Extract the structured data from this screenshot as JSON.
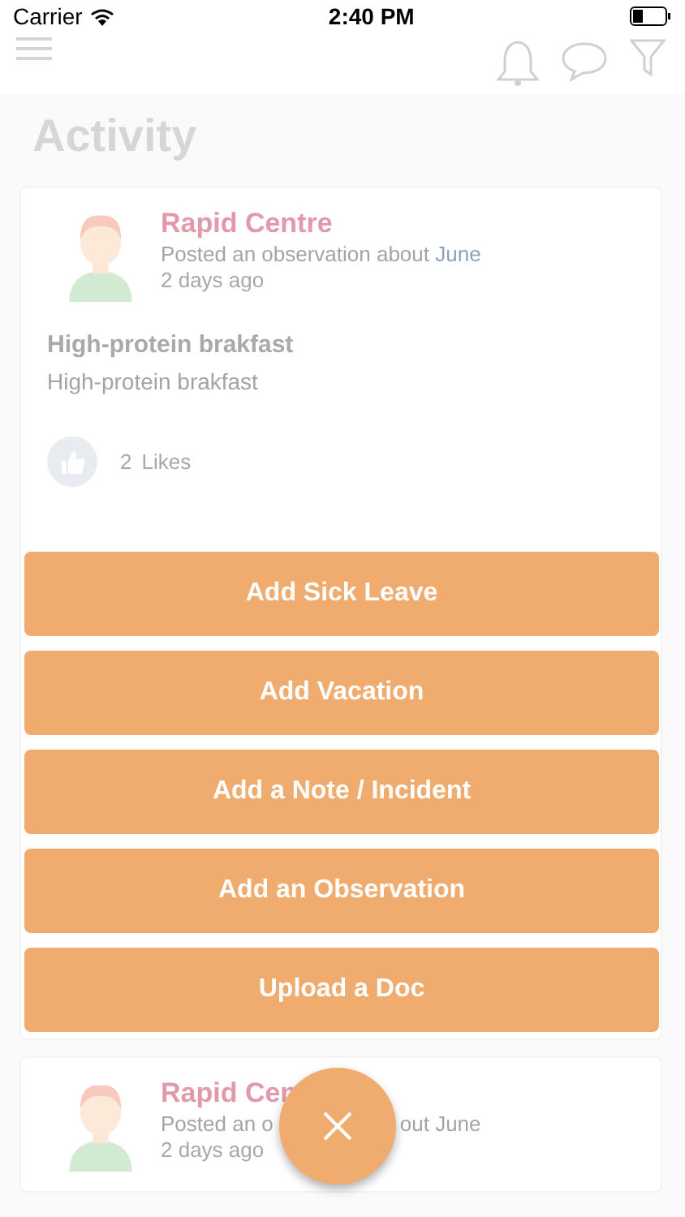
{
  "status_bar": {
    "carrier": "Carrier",
    "time": "2:40 PM"
  },
  "page": {
    "title": "Activity"
  },
  "posts": [
    {
      "author": "Rapid Centre",
      "action": "Posted an observation about",
      "subject": "June",
      "time": "2 days ago",
      "title": "High-protein brakfast",
      "body": "High-protein brakfast",
      "like_count": "2",
      "like_label": "Likes"
    }
  ],
  "partial_post": {
    "author": "Rapid Cen",
    "action_start": "Posted an o",
    "action_end": "out June",
    "time": "2 days ago"
  },
  "actions": [
    "Add Sick Leave",
    "Add Vacation",
    "Add a Note / Incident",
    "Add an Observation",
    "Upload a Doc"
  ]
}
